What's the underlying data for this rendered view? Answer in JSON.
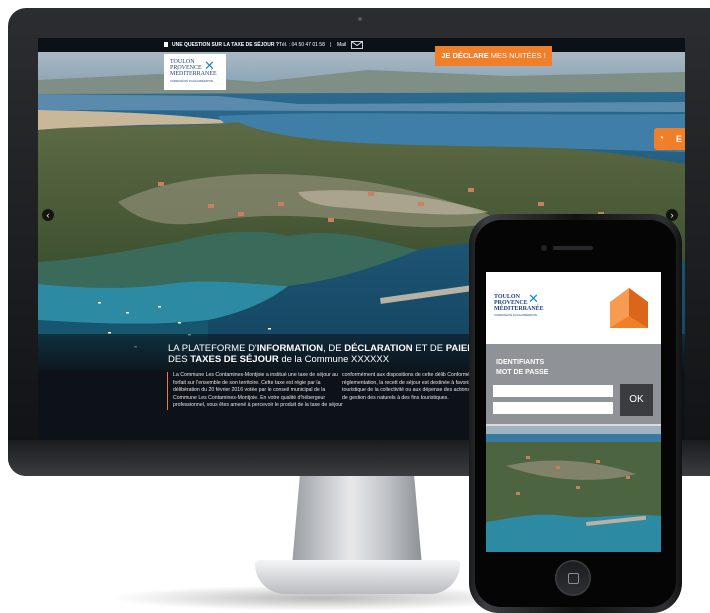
{
  "desktop": {
    "topbar": {
      "question": "UNE QUESTION SUR LA TAXE DE SÉJOUR ?",
      "phone": "Tél. : 04 50 47 01 58",
      "separator": "|",
      "mail": "Mail"
    },
    "logo": {
      "line1": "TOULON",
      "line2": "PROVENCE",
      "line3": "MÉDITERRANÉE",
      "tagline": "COMMUNAUTÉ D'AGGLOMÉRATION"
    },
    "declare_button": {
      "bold": "JE DÉCLARE",
      "light": "MES NUITÉES !"
    },
    "side_tab": "E",
    "slider": {
      "prev": "‹",
      "next": "›"
    },
    "headline": {
      "part1": "LA PLATEFORME D'",
      "bold1": "INFORMATION",
      "part2": ", DE ",
      "bold2": "DÉCLARATION",
      "part3": " ET DE ",
      "bold3": "PAIEME",
      "part4": "DES ",
      "bold4": "TAXES DE SÉJOUR",
      "part5": " de la Commune XXXXXX"
    },
    "body_col1": "La Commune Les Contamines-Montjoie a institué une taxe de séjour au forfait sur l'ensemble de son territoire. Cette taxe est régie par la délibération du 20 février 2016 votée par le conseil municipal de la Commune Les Contamines-Montjoie. En votre qualité d'hébergeur professionnel, vous êtes amené à percevoir le produit de la taxe de séjour",
    "body_col2": "conformément aux dispositions de cette délib Conformément à la réglementation, la recett de séjour est destinée à favoriser la fréquent touristique de la collectivité ou aux dépense des actions de protection et de gestion des naturels à des fins touristiques."
  },
  "mobile": {
    "logo": {
      "line1": "TOULON",
      "line2": "PROVENCE",
      "line3": "MÉDITERRANÉE",
      "tagline": "COMMUNAUTÉ D'AGGLOMÉRATION"
    },
    "login": {
      "identifiants": "IDENTIFIANTS",
      "password": "MOT DE PASSE",
      "ok": "OK"
    }
  },
  "colors": {
    "accent": "#f07f2a",
    "brand_blue": "#1d3f86",
    "dark_bar": "#0b1117"
  },
  "icons": [
    "mail-icon",
    "chevron-left-icon",
    "chevron-right-icon",
    "ear-icon",
    "house-icon",
    "home-button-icon"
  ]
}
